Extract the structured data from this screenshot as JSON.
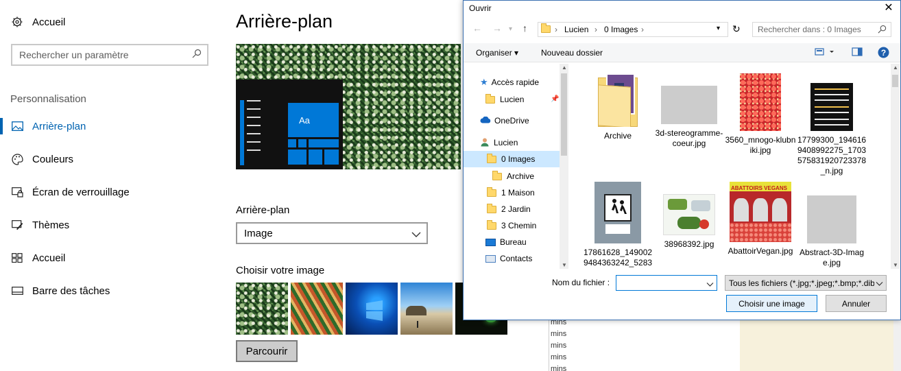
{
  "settings": {
    "home_label": "Accueil",
    "search_placeholder": "Rechercher un paramètre",
    "section_title": "Personnalisation",
    "nav": [
      {
        "label": "Arrière-plan",
        "icon": "picture-icon",
        "active": true
      },
      {
        "label": "Couleurs",
        "icon": "palette-icon"
      },
      {
        "label": "Écran de verrouillage",
        "icon": "lock-screen-icon"
      },
      {
        "label": "Thèmes",
        "icon": "themes-icon"
      },
      {
        "label": "Accueil",
        "icon": "start-icon"
      },
      {
        "label": "Barre des tâches",
        "icon": "taskbar-icon"
      }
    ],
    "page_title": "Arrière-plan",
    "preview_sample": "Aa",
    "background_label": "Arrière-plan",
    "background_value": "Image",
    "choose_label": "Choisir votre image",
    "browse_label": "Parcourir",
    "accent_color": "#0063b1"
  },
  "behind_window": {
    "rows": [
      "mins",
      "mins",
      "mins",
      "mins",
      "mins"
    ]
  },
  "dialog": {
    "title": "Ouvrir",
    "breadcrumb": [
      "Lucien",
      "0 Images"
    ],
    "search_placeholder": "Rechercher dans : 0 Images",
    "organize_label": "Organiser ▾",
    "new_folder_label": "Nouveau dossier",
    "tree": [
      {
        "label": "Accès rapide",
        "icon": "star-icon",
        "indent": 0
      },
      {
        "label": "Lucien",
        "icon": "folder-icon",
        "indent": 1
      },
      {
        "label": "OneDrive",
        "icon": "cloud-icon",
        "indent": 0
      },
      {
        "label": "Lucien",
        "icon": "user-icon",
        "indent": 0
      },
      {
        "label": "0 Images",
        "icon": "folder-icon",
        "indent": 1,
        "selected": true
      },
      {
        "label": "Archive",
        "icon": "folder-icon",
        "indent": 2
      },
      {
        "label": "1 Maison",
        "icon": "folder-icon",
        "indent": 1
      },
      {
        "label": "2 Jardin",
        "icon": "folder-icon",
        "indent": 1
      },
      {
        "label": "3 Chemin",
        "icon": "folder-icon",
        "indent": 1
      },
      {
        "label": "Bureau",
        "icon": "desktop-icon",
        "indent": 1
      },
      {
        "label": "Contacts",
        "icon": "contacts-icon",
        "indent": 1
      }
    ],
    "files": [
      {
        "name": "Archive",
        "kind": "folder"
      },
      {
        "name": "3d-stereogramme-coeur.jpg",
        "kind": "stereo"
      },
      {
        "name": "3560_mnogo-klubniki.jpg",
        "kind": "strawberry"
      },
      {
        "name": "17799300_1946169408992275_1703575831920723378_n.jpg",
        "kind": "text-poster"
      },
      {
        "name": "17861628_1490029484363242_5283",
        "kind": "sign"
      },
      {
        "name": "38968392.jpg",
        "kind": "cartoon"
      },
      {
        "name": "AbattoirVegan.jpg",
        "kind": "vegan"
      },
      {
        "name": "Abstract-3D-Image.jpg",
        "kind": "stereo"
      }
    ],
    "poster_title": "ABATTOIRS VEGANS",
    "filename_label": "Nom du fichier :",
    "filename_value": "",
    "filter_value": "Tous les fichiers (*.jpg;*.jpeg;*.bmp;*.dib",
    "open_label": "Choisir une image",
    "cancel_label": "Annuler"
  }
}
